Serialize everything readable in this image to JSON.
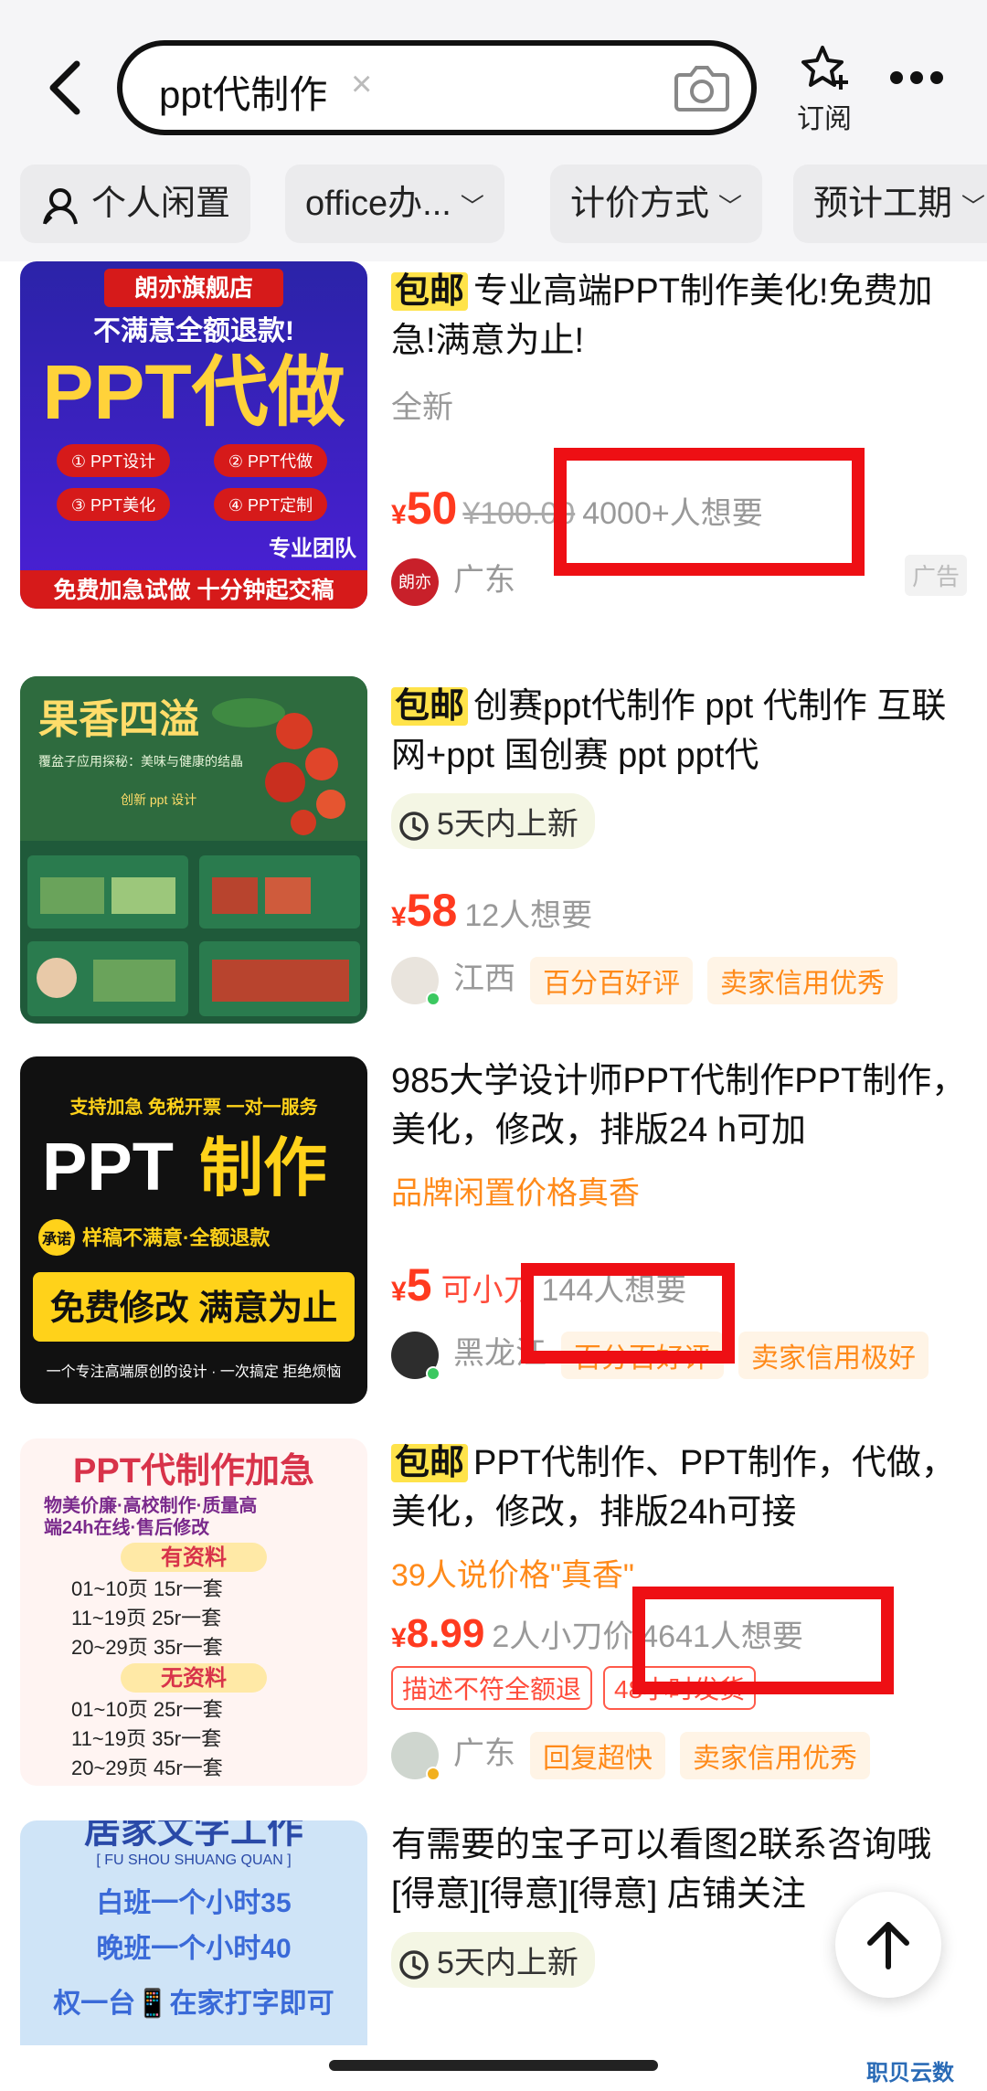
{
  "header": {
    "search_value": "ppt代制作",
    "clear_symbol": "×",
    "subscribe_label": "订阅"
  },
  "filters": [
    {
      "label": "个人闲置"
    },
    {
      "label": "office办..."
    },
    {
      "label": "计价方式"
    },
    {
      "label": "预计工期"
    }
  ],
  "items": [
    {
      "tag": "包邮",
      "title": "专业高端PPT制作美化!免费加急!满意为止!",
      "condition": "全新",
      "yen": "¥",
      "price": "50",
      "original_price": "¥100.00",
      "want": "4000+人想要",
      "seller_avatar": "朗亦",
      "location": "广东",
      "ad_label": "广告",
      "thumb": {
        "shop": "朗亦旗舰店",
        "guarantee": "不满意全额退款!",
        "headline": "PPT代做",
        "services": [
          "① PPT设计",
          "② PPT代做",
          "③ PPT美化",
          "④ PPT定制"
        ],
        "team": "专业团队",
        "footer": "免费加急试做 十分钟起交稿"
      }
    },
    {
      "tag": "包邮",
      "title": "创赛ppt代制作 ppt 代制作 互联网+ppt  国创赛 ppt  ppt代",
      "badge": "5天内上新",
      "yen": "¥",
      "price": "58",
      "want": "12人想要",
      "location": "江西",
      "tags": [
        "百分百好评",
        "卖家信用优秀"
      ],
      "thumb": {
        "headline": "果香四溢",
        "subtitle": "覆盆子应用探秘：美味与健康的结晶",
        "mark": "创新 ppt 设计"
      }
    },
    {
      "title": "985大学设计师PPT代制作PPT制作，美化，修改，排版24 h可加",
      "brand_text": "品牌闲置价格真香",
      "yen": "¥",
      "price": "5",
      "bargain": "可小刀",
      "want": "144人想要",
      "location": "黑龙江",
      "tags": [
        "百分百好评",
        "卖家信用极好"
      ],
      "thumb": {
        "top": "支持加急  免税开票  一对一服务",
        "headline_a": "PPT",
        "headline_b": "制作",
        "promise_tag": "承诺",
        "promise": "样稿不满意·全额退款",
        "banner": "免费修改 满意为止",
        "footer": "一个专注高端原创的设计 · 一次搞定  拒绝烦恼"
      }
    },
    {
      "tag": "包邮",
      "title": "PPT代制作、PPT制作，代做，美化，修改，排版24h可接",
      "price_note": "39人说价格\"真香\"",
      "yen": "¥",
      "price": "8.99",
      "bargain": "2人小刀价",
      "want": "4641人想要",
      "red_tags": [
        "描述不符全额退",
        "48小时发货"
      ],
      "location": "广东",
      "tags": [
        "回复超快",
        "卖家信用优秀"
      ],
      "thumb": {
        "headline": "PPT代制作加急",
        "sub1": "物美价廉·高校制作·质量高",
        "sub2": "端24h在线·售后修改",
        "section_a": "有资料",
        "rows_a": [
          "01~10页    15r一套",
          "11~19页    25r一套",
          "20~29页    35r一套"
        ],
        "section_b": "无资料",
        "rows_b": [
          "01~10页    25r一套",
          "11~19页    35r一套",
          "20~29页    45r一套"
        ]
      }
    },
    {
      "title": "有需要的宝子可以看图2联系咨询哦[得意][得意][得意] 店铺关注",
      "badge": "5天内上新",
      "thumb": {
        "headline": "居家文字工作",
        "pinyin": "[ FU SHOU SHUANG QUAN ]",
        "line1": "白班一个小时35",
        "line2": "晚班一个小时40",
        "line3": "权一台📱在家打字即可"
      }
    }
  ],
  "watermark": "职贝云数"
}
